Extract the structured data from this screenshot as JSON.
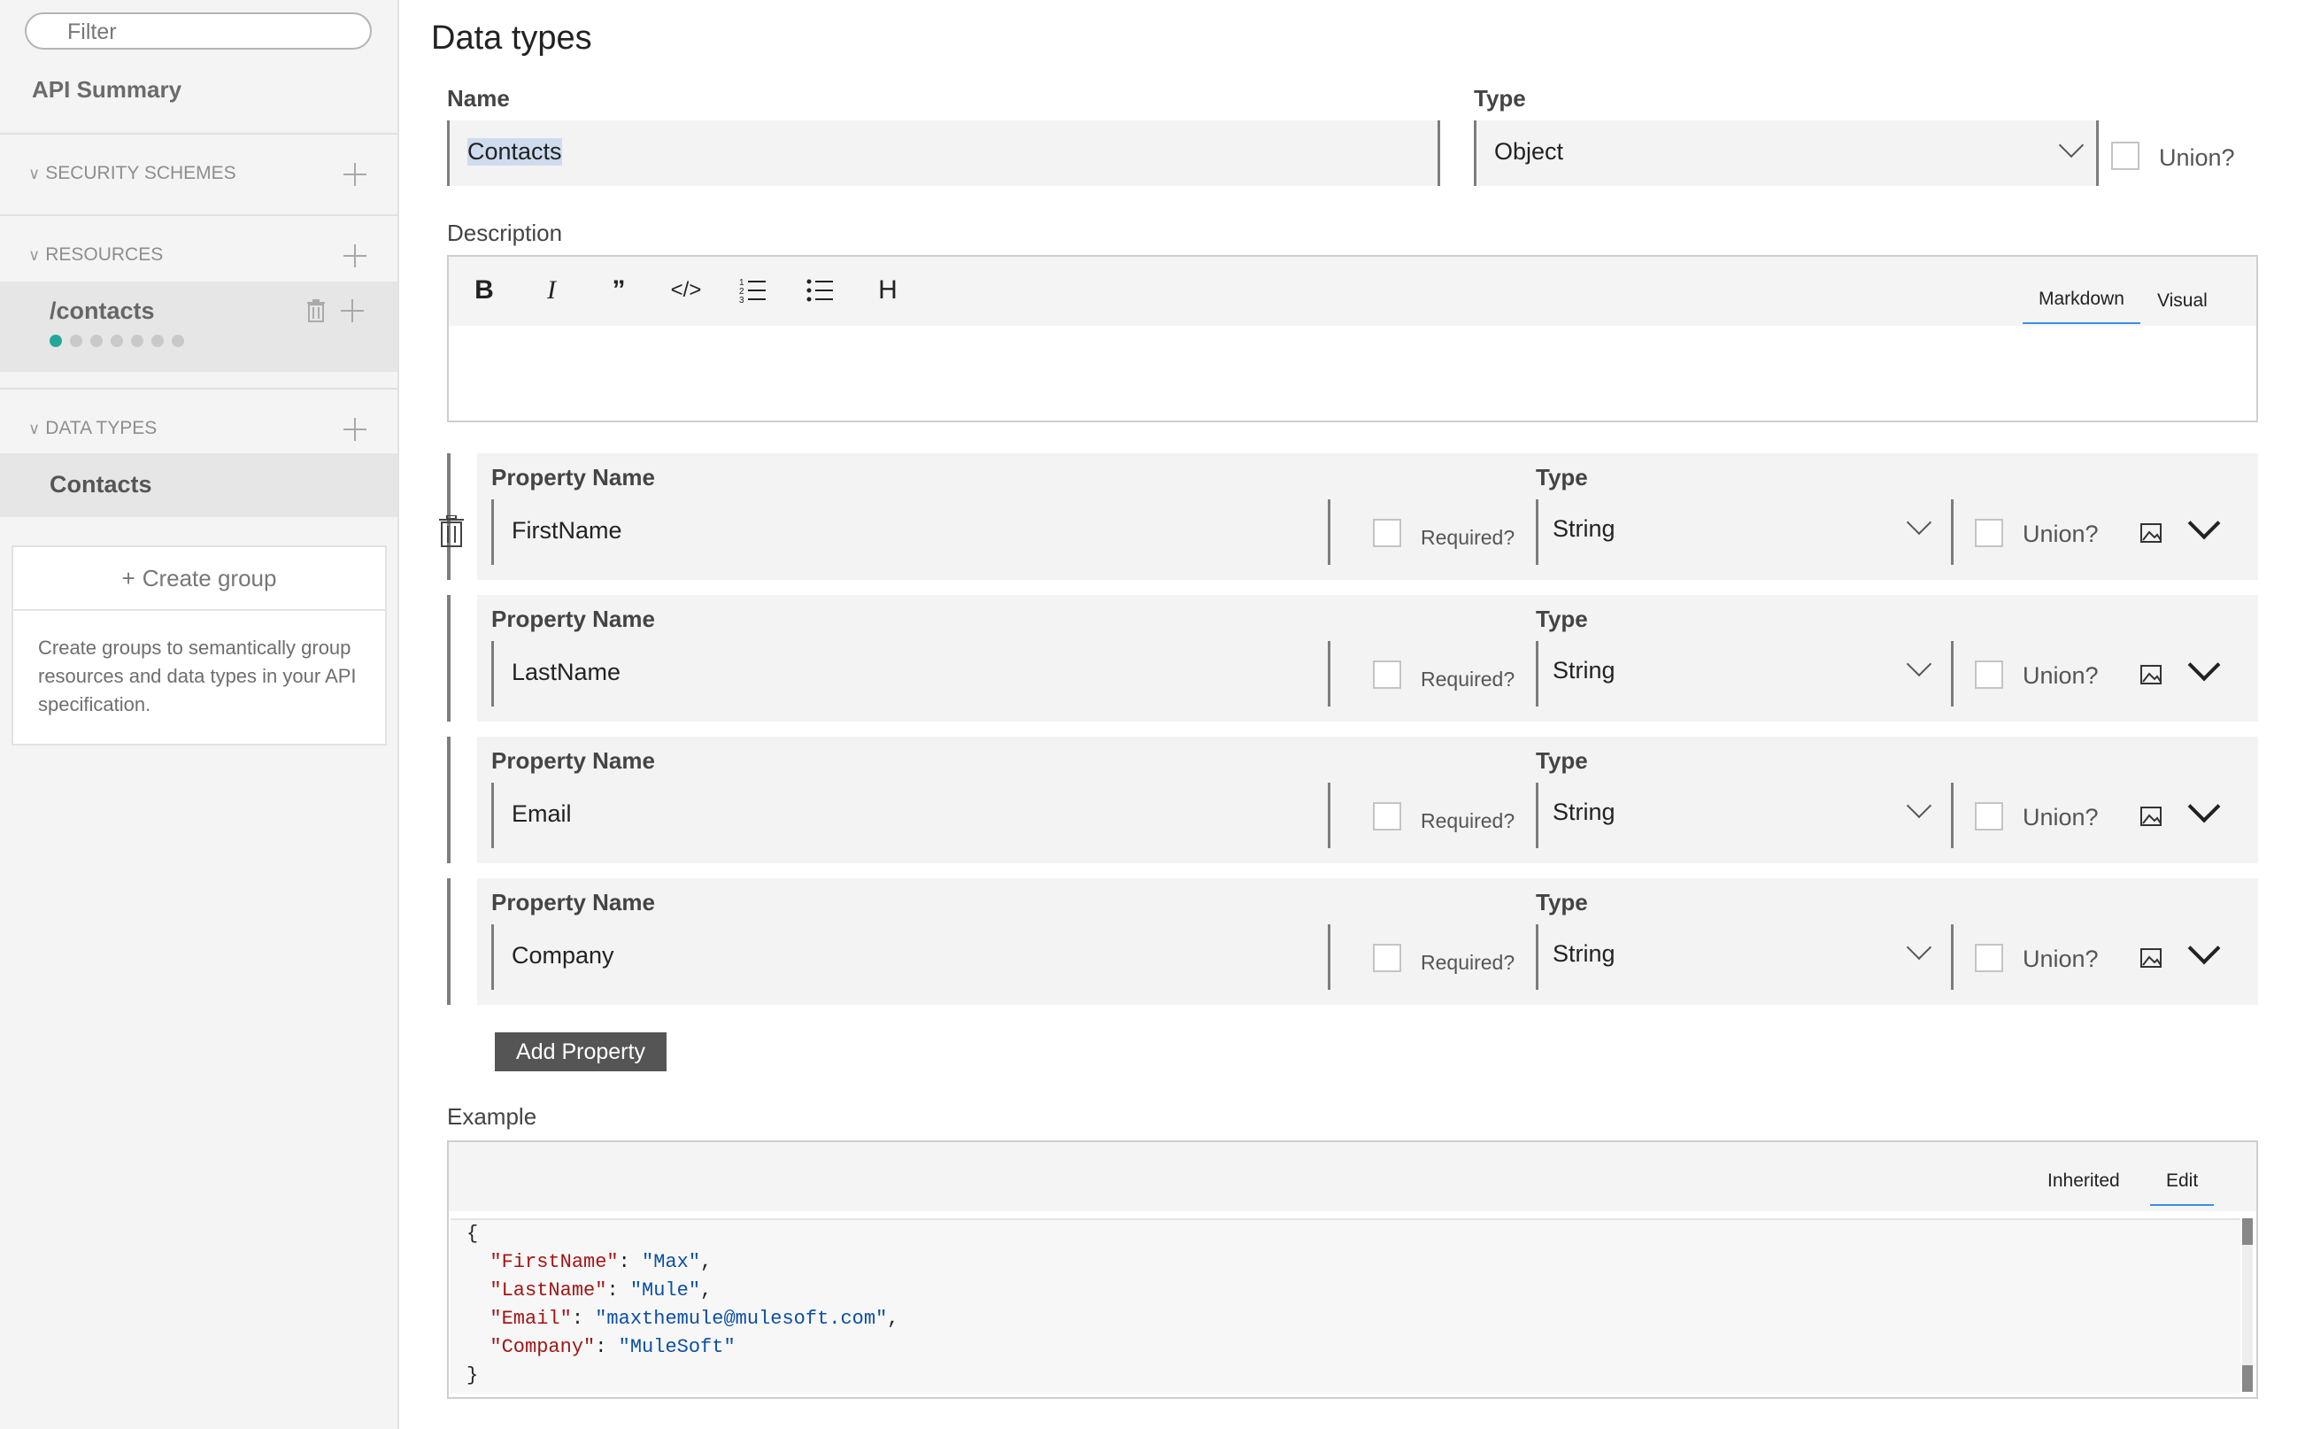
{
  "sidebar": {
    "filter_placeholder": "Filter",
    "api_summary": "API Summary",
    "sections": {
      "security": "SECURITY SCHEMES",
      "resources": "RESOURCES",
      "data_types": "DATA TYPES"
    },
    "resource": {
      "path": "/contacts",
      "dots": 7,
      "active_dot": 0
    },
    "data_type_item": "Contacts",
    "group": {
      "button": "Create group",
      "help": "Create groups to semantically group resources and data types in your API specification."
    }
  },
  "main": {
    "title": "Data types",
    "name_label": "Name",
    "name_value": "Contacts",
    "type_label": "Type",
    "type_value": "Object",
    "union_label": "Union?",
    "description_label": "Description",
    "toolbar": {
      "bold": "B",
      "italic": "I",
      "quote": "”",
      "code": "</>",
      "heading": "H",
      "tab_markdown": "Markdown",
      "tab_visual": "Visual"
    },
    "properties": [
      {
        "name_label": "Property Name",
        "name": "FirstName",
        "required_label": "Required?",
        "type_label": "Type",
        "type": "String",
        "union_label": "Union?"
      },
      {
        "name_label": "Property Name",
        "name": "LastName",
        "required_label": "Required?",
        "type_label": "Type",
        "type": "String",
        "union_label": "Union?"
      },
      {
        "name_label": "Property Name",
        "name": "Email",
        "required_label": "Required?",
        "type_label": "Type",
        "type": "String",
        "union_label": "Union?"
      },
      {
        "name_label": "Property Name",
        "name": "Company",
        "required_label": "Required?",
        "type_label": "Type",
        "type": "String",
        "union_label": "Union?"
      }
    ],
    "add_property": "Add Property",
    "example_label": "Example",
    "example_tabs": {
      "inherited": "Inherited",
      "edit": "Edit"
    },
    "example_code": [
      {
        "key": "\"FirstName\"",
        "value": "\"Max\"",
        "trail": ","
      },
      {
        "key": "\"LastName\"",
        "value": "\"Mule\"",
        "trail": ","
      },
      {
        "key": "\"Email\"",
        "value": "\"maxthemule@mulesoft.com\"",
        "trail": ","
      },
      {
        "key": "\"Company\"",
        "value": "\"MuleSoft\"",
        "trail": ""
      }
    ],
    "code_open": "{",
    "code_close": "}"
  }
}
